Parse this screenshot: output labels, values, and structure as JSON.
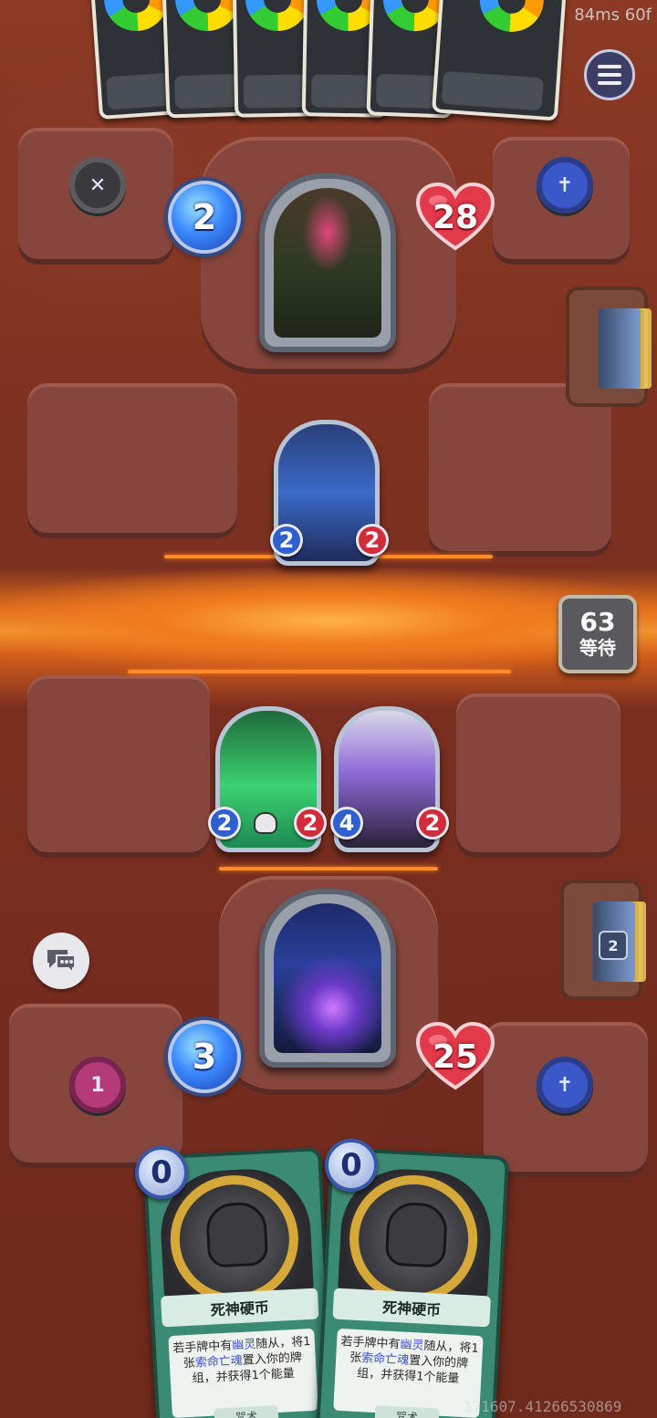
{
  "hud": {
    "fps_text": "84ms 60f",
    "debug_id": "171607.41266530869"
  },
  "opponent": {
    "mana": "2",
    "health": "28",
    "hand_count": 6
  },
  "player": {
    "mana": "3",
    "health": "25",
    "left_socket_value": "1",
    "deck_count": "2"
  },
  "board": {
    "opponent_minions": [
      {
        "attack": "2",
        "health": "2"
      }
    ],
    "player_minions": [
      {
        "attack": "2",
        "health": "2"
      },
      {
        "attack": "4",
        "health": "2"
      }
    ]
  },
  "turn": {
    "number": "63",
    "label": "等待"
  },
  "hand": [
    {
      "cost": "0",
      "name": "死神硬币",
      "desc_1": "若手牌中有",
      "kw_1": "幽灵",
      "desc_2": "随从，将1张",
      "kw_2": "索命亡魂",
      "desc_3": "置入你的牌组，并获得1个能量",
      "type": "咒术"
    },
    {
      "cost": "0",
      "name": "死神硬币",
      "desc_1": "若手牌中有",
      "kw_1": "幽灵",
      "desc_2": "随从，将1张",
      "kw_2": "索命亡魂",
      "desc_3": "置入你的牌组，并获得1个能量",
      "type": "咒术"
    }
  ],
  "colors": {
    "mana_blue": "#3b8bff",
    "health_red": "#e23a4a",
    "keyword_blue": "#3b4fd8",
    "card_green": "#3b8a74"
  },
  "icons": {
    "menu": "menu-icon",
    "chat": "chat-icon",
    "tombstone": "tombstone-icon"
  }
}
